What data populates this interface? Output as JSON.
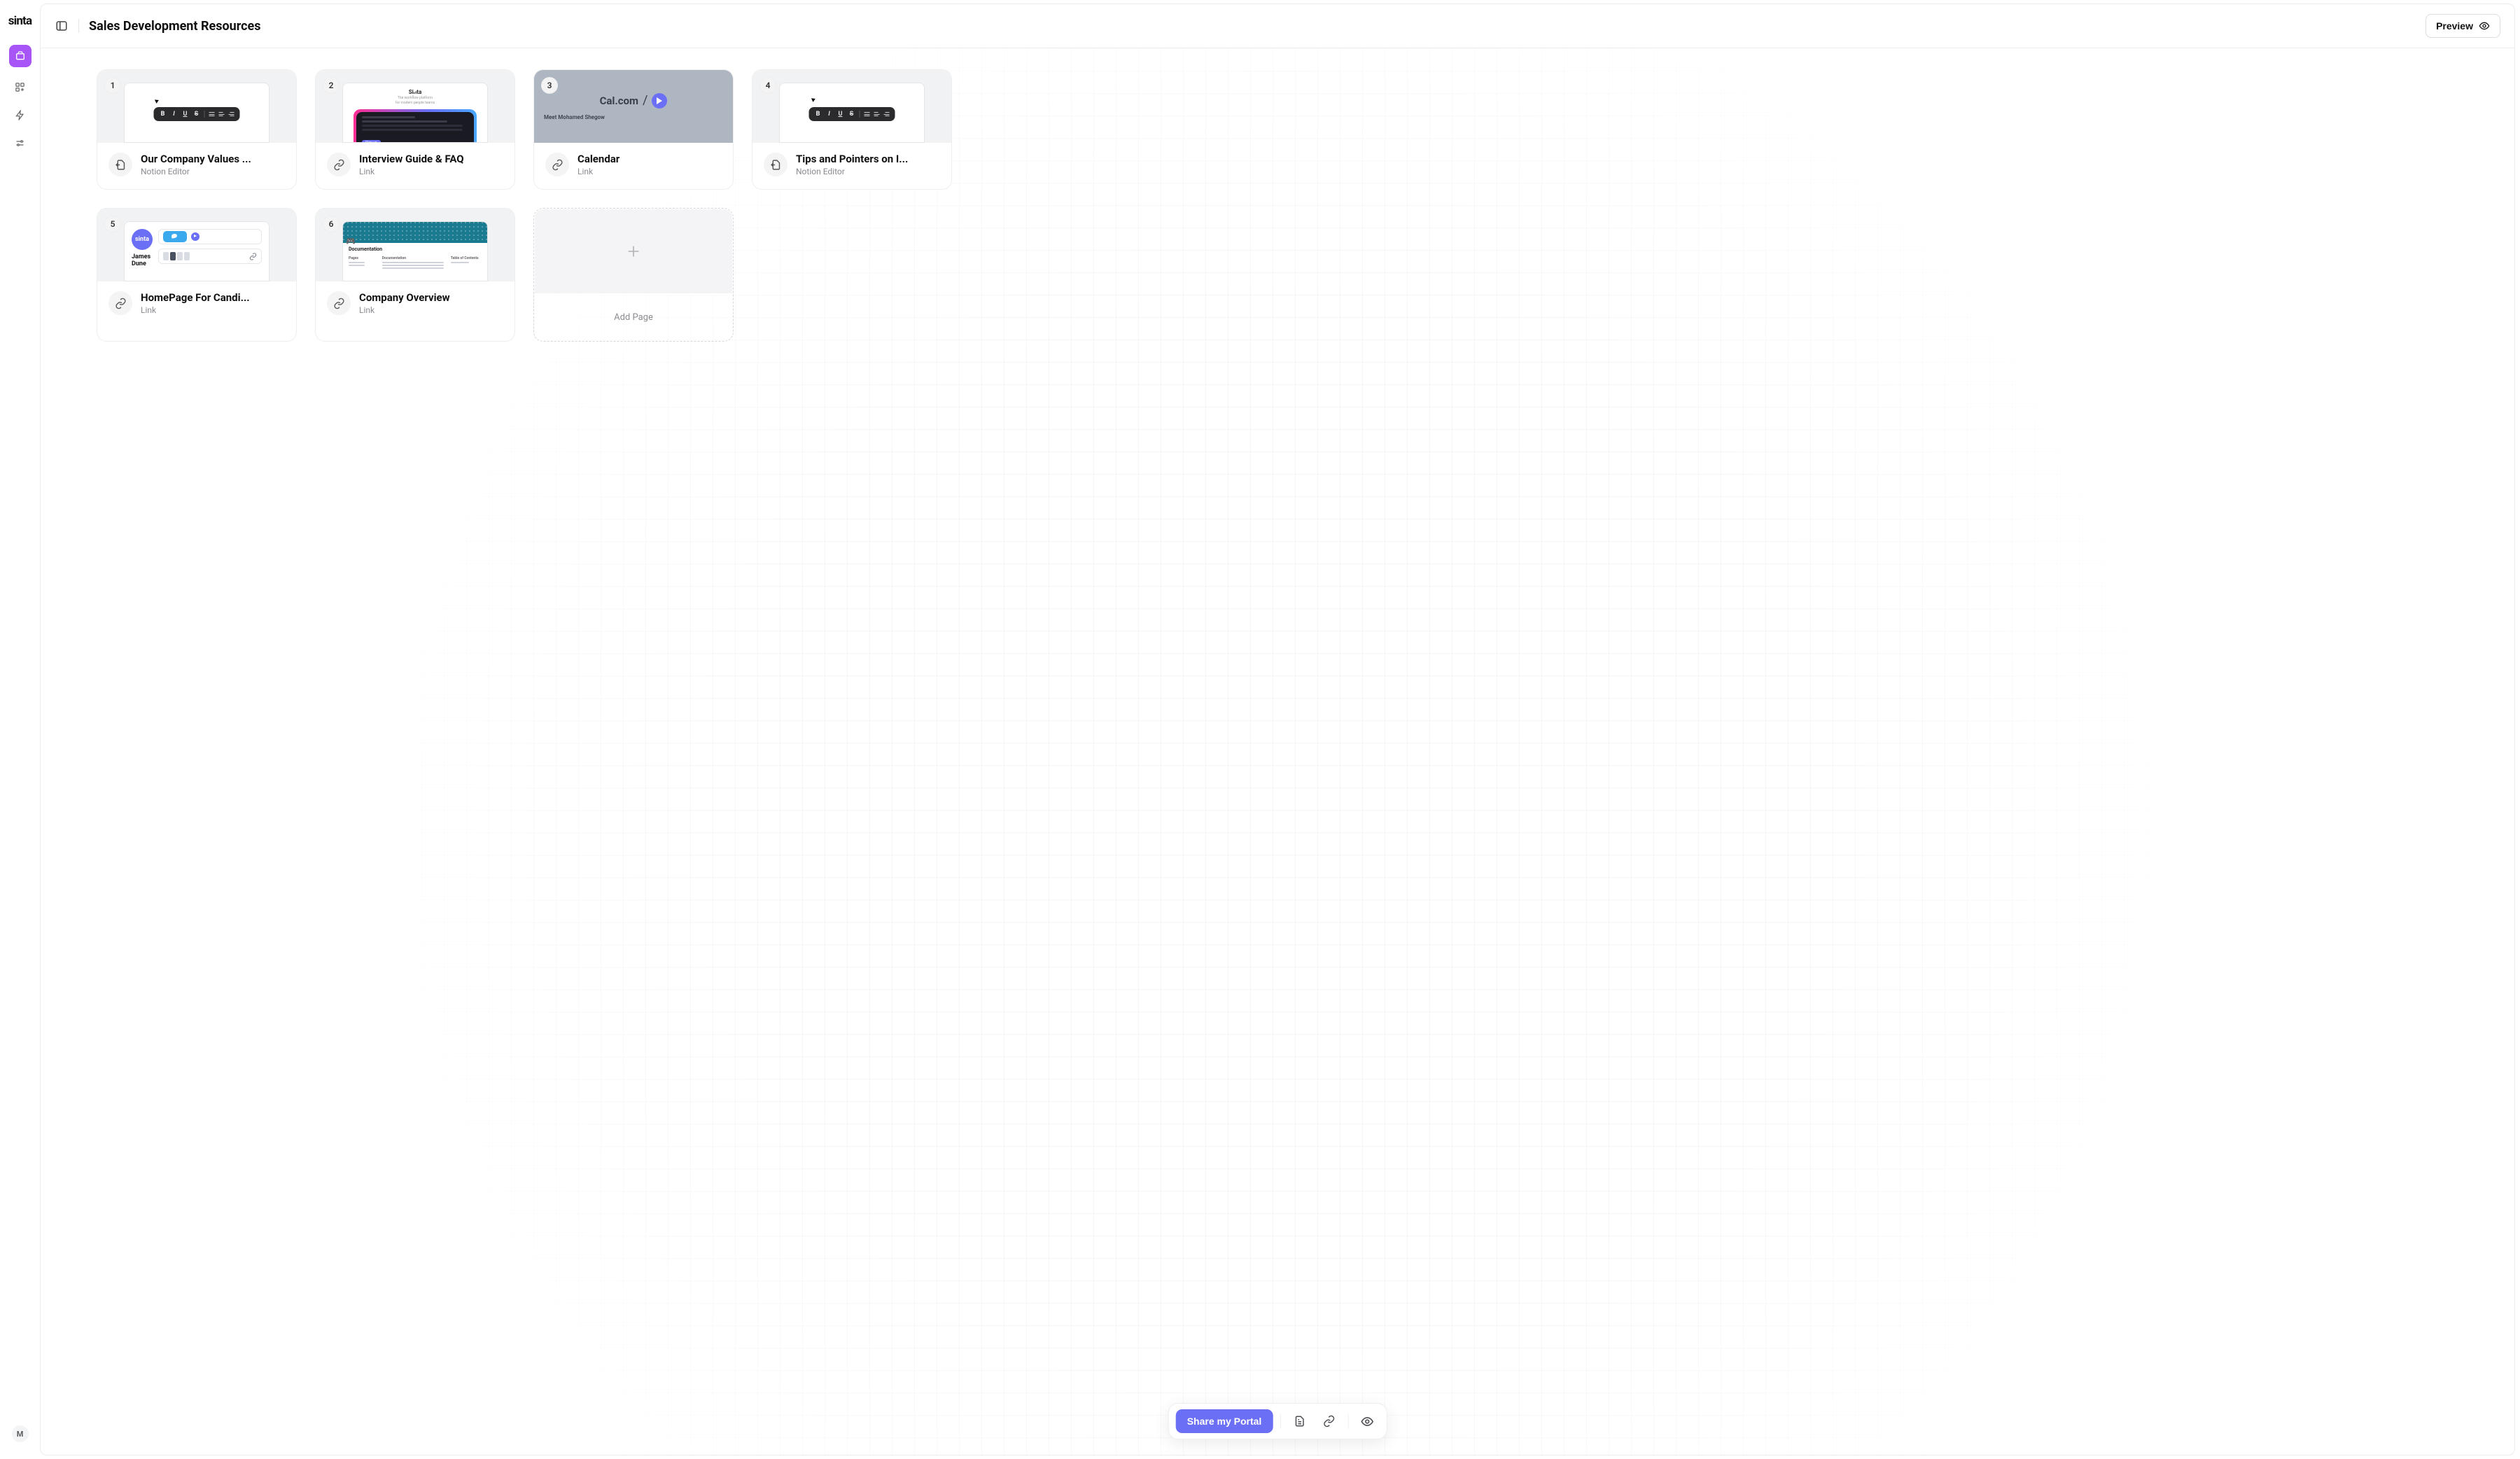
{
  "brand": "sinta",
  "avatar_initial": "M",
  "page_title": "Sales Development Resources",
  "preview_button": "Preview",
  "share_button": "Share my Portal",
  "add_page_label": "Add Page",
  "thumb2": {
    "brand": "Sinta",
    "tagline1": "The workflow platform",
    "tagline2": "for modern people teams",
    "chip": "Sign up"
  },
  "thumb3": {
    "brand": "Cal.com",
    "meet": "Meet Mohamed Shegow"
  },
  "thumb5": {
    "avatar": "sinta",
    "name1": "James",
    "name2": "Dune"
  },
  "thumb6": {
    "heading": "Documentation",
    "col1": "Pages",
    "col2": "Documentation",
    "col3": "Table of Contents"
  },
  "cards": [
    {
      "num": "1",
      "title": "Our Company Values ...",
      "sub": "Notion Editor",
      "icon": "file",
      "thumb": "toolbar"
    },
    {
      "num": "2",
      "title": "Interview Guide & FAQ",
      "sub": "Link",
      "icon": "link",
      "thumb": "sinta"
    },
    {
      "num": "3",
      "title": "Calendar",
      "sub": "Link",
      "icon": "link",
      "thumb": "cal"
    },
    {
      "num": "4",
      "title": "Tips and Pointers on I...",
      "sub": "Notion Editor",
      "icon": "file",
      "thumb": "toolbar2"
    },
    {
      "num": "5",
      "title": "HomePage For Candi...",
      "sub": "Link",
      "icon": "link",
      "thumb": "profile"
    },
    {
      "num": "6",
      "title": "Company Overview",
      "sub": "Link",
      "icon": "link",
      "thumb": "docs"
    }
  ]
}
